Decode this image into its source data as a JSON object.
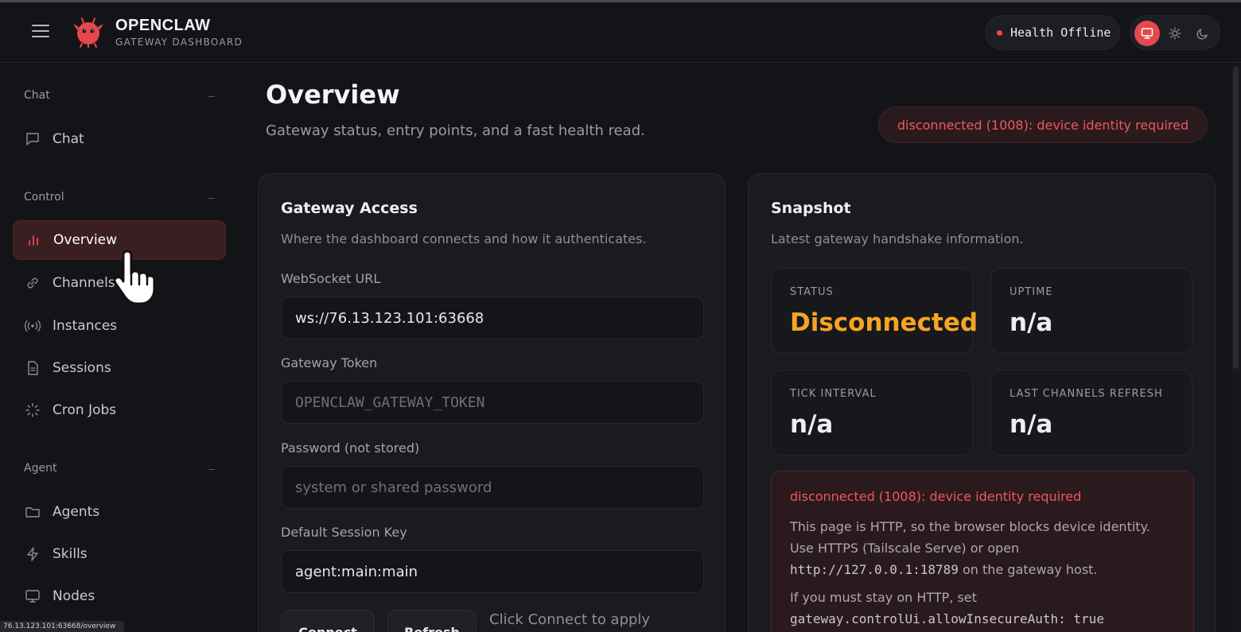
{
  "header": {
    "brand_title": "OPENCLAW",
    "brand_subtitle": "GATEWAY DASHBOARD",
    "health_label": "Health Offline",
    "colors": {
      "accent": "#e5484d",
      "danger": "#ef4444",
      "warning": "#f5a524"
    }
  },
  "sidebar": {
    "sections": [
      {
        "label": "Chat",
        "items": [
          {
            "label": "Chat",
            "icon": "message-square-icon"
          }
        ]
      },
      {
        "label": "Control",
        "items": [
          {
            "label": "Overview",
            "icon": "bar-chart-icon",
            "active": true
          },
          {
            "label": "Channels",
            "icon": "link-icon"
          },
          {
            "label": "Instances",
            "icon": "radio-signal-icon"
          },
          {
            "label": "Sessions",
            "icon": "file-text-icon"
          },
          {
            "label": "Cron Jobs",
            "icon": "loader-icon"
          }
        ]
      },
      {
        "label": "Agent",
        "items": [
          {
            "label": "Agents",
            "icon": "folder-icon"
          },
          {
            "label": "Skills",
            "icon": "zap-icon"
          },
          {
            "label": "Nodes",
            "icon": "monitor-icon"
          }
        ]
      }
    ]
  },
  "main": {
    "title": "Overview",
    "subtitle": "Gateway status, entry points, and a fast health read.",
    "error_banner": "disconnected (1008): device identity required"
  },
  "gateway_access": {
    "title": "Gateway Access",
    "subtitle": "Where the dashboard connects and how it authenticates.",
    "websocket_label": "WebSocket URL",
    "websocket_value": "ws://76.13.123.101:63668",
    "token_label": "Gateway Token",
    "token_placeholder": "OPENCLAW_GATEWAY_TOKEN",
    "password_label": "Password (not stored)",
    "password_placeholder": "system or shared password",
    "session_label": "Default Session Key",
    "session_value": "agent:main:main",
    "connect_label": "Connect",
    "refresh_label": "Refresh",
    "hint": "Click Connect to apply"
  },
  "snapshot": {
    "title": "Snapshot",
    "subtitle": "Latest gateway handshake information.",
    "stats": [
      {
        "label": "STATUS",
        "value": "Disconnected"
      },
      {
        "label": "UPTIME",
        "value": "n/a"
      },
      {
        "label": "TICK INTERVAL",
        "value": "n/a"
      },
      {
        "label": "LAST CHANNELS REFRESH",
        "value": "n/a"
      }
    ],
    "alert": {
      "title": "disconnected (1008): device identity required",
      "line1": "This page is HTTP, so the browser blocks device identity.",
      "line2": "Use HTTPS (Tailscale Serve) or open",
      "line3_code": "http://127.0.0.1:18789",
      "line3_text": " on the gateway host.",
      "line4": "If you must stay on HTTP, set",
      "line5_code": "gateway.controlUi.allowInsecureAuth: true"
    }
  },
  "statusbar": {
    "url": "76.13.123.101:63668/overview"
  }
}
